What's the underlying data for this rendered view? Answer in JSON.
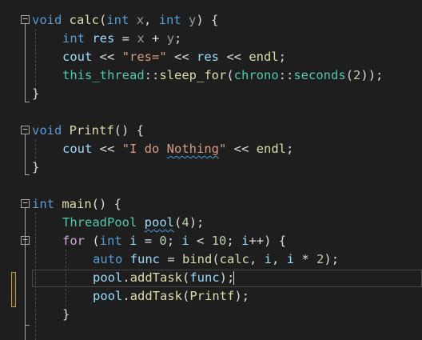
{
  "colors": {
    "background": "#1e1e1e",
    "keyword": "#569cd6",
    "function": "#dcdcaa",
    "type": "#4ec9b0",
    "variable": "#9cdcfe",
    "string": "#d69d85",
    "number": "#b5cea8",
    "text": "#dcdcdc",
    "change_bar": "#57a64a",
    "change_pending": "#c8a02c"
  },
  "code": {
    "lines": [
      [
        {
          "t": "void",
          "c": "#569cd6"
        },
        {
          "t": " "
        },
        {
          "t": "calc",
          "c": "#dcdcaa"
        },
        {
          "t": "("
        },
        {
          "t": "int",
          "c": "#569cd6"
        },
        {
          "t": " "
        },
        {
          "t": "x",
          "c": "#9a9a9a"
        },
        {
          "t": ", "
        },
        {
          "t": "int",
          "c": "#569cd6"
        },
        {
          "t": " "
        },
        {
          "t": "y",
          "c": "#9a9a9a"
        },
        {
          "t": ") {"
        }
      ],
      [
        {
          "t": "int",
          "c": "#569cd6"
        },
        {
          "t": " "
        },
        {
          "t": "res",
          "c": "#9cdcfe"
        },
        {
          "t": " = "
        },
        {
          "t": "x",
          "c": "#9a9a9a"
        },
        {
          "t": " + "
        },
        {
          "t": "y",
          "c": "#9a9a9a"
        },
        {
          "t": ";"
        }
      ],
      [
        {
          "t": "cout",
          "c": "#9cdcfe"
        },
        {
          "t": " << "
        },
        {
          "t": "\"res=\"",
          "c": "#d69d85"
        },
        {
          "t": " << "
        },
        {
          "t": "res",
          "c": "#9cdcfe"
        },
        {
          "t": " << "
        },
        {
          "t": "endl",
          "c": "#dcdcaa"
        },
        {
          "t": ";"
        }
      ],
      [
        {
          "t": "this_thread",
          "c": "#4ec9b0"
        },
        {
          "t": "::"
        },
        {
          "t": "sleep_for",
          "c": "#dcdcaa"
        },
        {
          "t": "("
        },
        {
          "t": "chrono",
          "c": "#4ec9b0"
        },
        {
          "t": "::"
        },
        {
          "t": "seconds",
          "c": "#4ec9b0"
        },
        {
          "t": "("
        },
        {
          "t": "2",
          "c": "#b5cea8"
        },
        {
          "t": "));"
        }
      ],
      [
        {
          "t": "}"
        }
      ],
      [],
      [
        {
          "t": "void",
          "c": "#569cd6"
        },
        {
          "t": " "
        },
        {
          "t": "Printf",
          "c": "#dcdcaa"
        },
        {
          "t": "() {"
        }
      ],
      [
        {
          "t": "cout",
          "c": "#9cdcfe"
        },
        {
          "t": " << "
        },
        {
          "t": "\"I do ",
          "c": "#d69d85"
        },
        {
          "t": "Nothing",
          "c": "#d69d85",
          "u": true
        },
        {
          "t": "\"",
          "c": "#d69d85"
        },
        {
          "t": " << "
        },
        {
          "t": "endl",
          "c": "#dcdcaa"
        },
        {
          "t": ";"
        }
      ],
      [
        {
          "t": "}"
        }
      ],
      [],
      [
        {
          "t": "int",
          "c": "#569cd6"
        },
        {
          "t": " "
        },
        {
          "t": "main",
          "c": "#dcdcaa"
        },
        {
          "t": "() {"
        }
      ],
      [
        {
          "t": "ThreadPool",
          "c": "#4ec9b0"
        },
        {
          "t": " "
        },
        {
          "t": "pool",
          "c": "#9cdcfe",
          "u": true
        },
        {
          "t": "("
        },
        {
          "t": "4",
          "c": "#b5cea8"
        },
        {
          "t": ");"
        }
      ],
      [
        {
          "t": "for",
          "c": "#d8a0df"
        },
        {
          "t": " ("
        },
        {
          "t": "int",
          "c": "#569cd6"
        },
        {
          "t": " "
        },
        {
          "t": "i",
          "c": "#9cdcfe"
        },
        {
          "t": " = "
        },
        {
          "t": "0",
          "c": "#b5cea8"
        },
        {
          "t": "; "
        },
        {
          "t": "i",
          "c": "#9cdcfe"
        },
        {
          "t": " < "
        },
        {
          "t": "10",
          "c": "#b5cea8"
        },
        {
          "t": "; "
        },
        {
          "t": "i",
          "c": "#9cdcfe"
        },
        {
          "t": "++) {"
        }
      ],
      [
        {
          "t": "auto",
          "c": "#569cd6"
        },
        {
          "t": " "
        },
        {
          "t": "func",
          "c": "#9cdcfe"
        },
        {
          "t": " = "
        },
        {
          "t": "bind",
          "c": "#dcdcaa"
        },
        {
          "t": "("
        },
        {
          "t": "calc",
          "c": "#dcdcaa"
        },
        {
          "t": ", "
        },
        {
          "t": "i",
          "c": "#9cdcfe"
        },
        {
          "t": ", "
        },
        {
          "t": "i",
          "c": "#9cdcfe"
        },
        {
          "t": " * "
        },
        {
          "t": "2",
          "c": "#b5cea8"
        },
        {
          "t": ");"
        }
      ],
      [
        {
          "t": "pool",
          "c": "#9cdcfe"
        },
        {
          "t": "."
        },
        {
          "t": "addTask",
          "c": "#dcdcaa"
        },
        {
          "t": "("
        },
        {
          "t": "func",
          "c": "#9cdcfe"
        },
        {
          "t": ");",
          "k": true
        }
      ],
      [
        {
          "t": "pool",
          "c": "#9cdcfe"
        },
        {
          "t": "."
        },
        {
          "t": "addTask",
          "c": "#dcdcaa"
        },
        {
          "t": "("
        },
        {
          "t": "Printf",
          "c": "#dcdcaa"
        },
        {
          "t": ");"
        }
      ],
      [
        {
          "t": "}"
        }
      ],
      []
    ]
  }
}
